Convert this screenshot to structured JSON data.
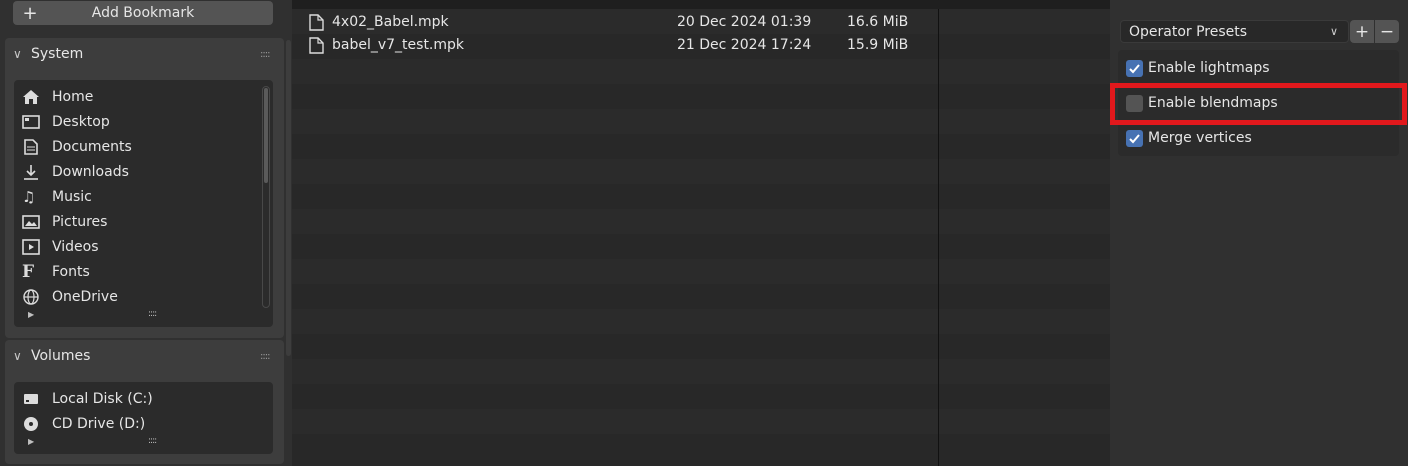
{
  "sidebar": {
    "add_bookmark_label": "Add Bookmark",
    "system": {
      "title": "System",
      "items": [
        {
          "label": "Home",
          "icon": "home-icon"
        },
        {
          "label": "Desktop",
          "icon": "desktop-icon"
        },
        {
          "label": "Documents",
          "icon": "documents-icon"
        },
        {
          "label": "Downloads",
          "icon": "downloads-icon"
        },
        {
          "label": "Music",
          "icon": "music-icon"
        },
        {
          "label": "Pictures",
          "icon": "pictures-icon"
        },
        {
          "label": "Videos",
          "icon": "videos-icon"
        },
        {
          "label": "Fonts",
          "icon": "fonts-icon"
        },
        {
          "label": "OneDrive",
          "icon": "globe-icon"
        }
      ]
    },
    "volumes": {
      "title": "Volumes",
      "items": [
        {
          "label": "Local Disk (C:)",
          "icon": "disk-icon"
        },
        {
          "label": "CD Drive (D:)",
          "icon": "cd-icon"
        }
      ]
    }
  },
  "files": [
    {
      "name": "4x02_Babel.mpk",
      "date": "20 Dec 2024 01:39",
      "size": "16.6 MiB"
    },
    {
      "name": "babel_v7_test.mpk",
      "date": "21 Dec 2024 17:24",
      "size": "15.9 MiB"
    }
  ],
  "operator": {
    "presets_label": "Operator Presets",
    "options": [
      {
        "label": "Enable lightmaps",
        "checked": true
      },
      {
        "label": "Enable blendmaps",
        "checked": false
      },
      {
        "label": "Merge vertices",
        "checked": true
      }
    ]
  },
  "colors": {
    "checkbox_on": "#4772b3",
    "highlight": "#e1181c"
  }
}
